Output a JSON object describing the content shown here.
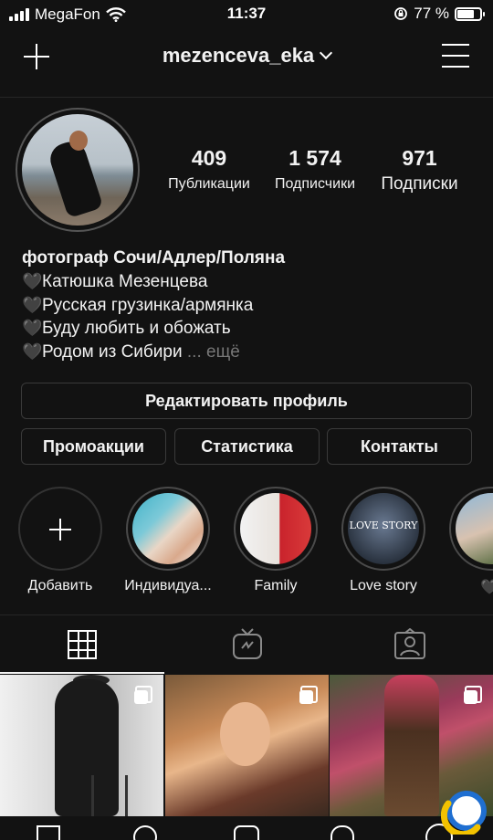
{
  "status_bar": {
    "carrier": "MegaFon",
    "time": "11:37",
    "battery_text": "77 %",
    "battery_level": 0.77,
    "signal_bars": 4
  },
  "header": {
    "username": "mezenceva_eka"
  },
  "profile": {
    "stats": [
      {
        "value": "409",
        "label": "Публикации"
      },
      {
        "value": "1 574",
        "label": "Подписчики"
      },
      {
        "value": "971",
        "label": "Подписки"
      }
    ],
    "bio": {
      "name": "фотограф Сочи/Адлер/Поляна",
      "lines": [
        "Катюшка Мезенцева",
        "Русская грузинка/армянка",
        "Буду любить и обожать",
        "Родом из Сибири"
      ],
      "heart_glyph": "🖤",
      "more": "... ещё"
    }
  },
  "buttons": {
    "edit_profile": "Редактировать профиль",
    "promotions": "Промоакции",
    "statistics": "Статистика",
    "contacts": "Контакты"
  },
  "highlights": [
    {
      "label": "Добавить",
      "icon": "plus-icon"
    },
    {
      "label": "Индивидуа..."
    },
    {
      "label": "Family"
    },
    {
      "label": "Love story",
      "cover_text": "LOVE STORY"
    },
    {
      "label": "🖤"
    }
  ],
  "tabs": [
    {
      "name": "grid",
      "icon": "grid-icon",
      "active": true
    },
    {
      "name": "igtv",
      "icon": "igtv-icon",
      "active": false
    },
    {
      "name": "tagged",
      "icon": "tagged-icon",
      "active": false
    }
  ],
  "posts": [
    {
      "multi": true,
      "tone": "monochrome"
    },
    {
      "multi": true,
      "tone": "warm"
    },
    {
      "multi": true,
      "tone": "garden"
    }
  ],
  "colors": {
    "background": "#121212",
    "text": "#f2f2f2",
    "border": "#3a3a3a",
    "muted": "#777777"
  }
}
